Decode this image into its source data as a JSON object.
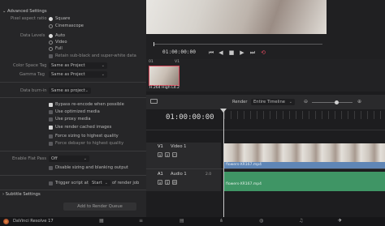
{
  "left_panel": {
    "advanced_settings": "Advanced Settings",
    "pixel_aspect_ratio_label": "Pixel aspect ratio",
    "pixel_aspect_options": [
      "Square",
      "Cinemascope"
    ],
    "data_levels_label": "Data Levels",
    "data_levels_options": [
      "Auto",
      "Video",
      "Full"
    ],
    "retain_checkbox": "Retain sub-black and super-white data",
    "color_space_tag_label": "Color Space Tag",
    "color_space_tag_value": "Same as Project",
    "gamma_tag_label": "Gamma Tag",
    "gamma_tag_value": "Same as Project",
    "data_burn_in_label": "Data burn-in",
    "data_burn_in_value": "Same as project",
    "checkboxes": [
      "Bypass re-encode when possible",
      "Use optimized media",
      "Use proxy media",
      "Use render cached images",
      "Force sizing to highest quality",
      "Force debayer to highest quality"
    ],
    "enable_flat_pass_label": "Enable Flat Pass",
    "enable_flat_pass_value": "Off",
    "disable_sizing": "Disable sizing and blanking output",
    "trigger_script_label": "Trigger script at",
    "trigger_script_value": "Start",
    "trigger_script_suffix": "of render job",
    "subtitle_settings": "Subtitle Settings",
    "add_to_render_queue": "Add to Render Queue"
  },
  "viewer": {
    "timecode": "01:00:00:00"
  },
  "media_pool": {
    "clip_number": "01",
    "clip_track": "V1",
    "clip_codec": "H.264 High L4.2"
  },
  "timeline": {
    "render_label": "Render",
    "render_value": "Entire Timeline",
    "timecode": "01:00:00:00",
    "video_track_id": "V1",
    "video_track_name": "Video 1",
    "audio_track_id": "A1",
    "audio_track_name": "Audio 1",
    "audio_track_level": "2.0",
    "video_clip_name": "flowers-XR167.mp4",
    "audio_clip_name": "flowers-XR167.mp4",
    "track_buttons_video": [
      "a",
      "o",
      "□"
    ],
    "track_buttons_audio": [
      "a",
      "S",
      "M"
    ]
  },
  "bottom_bar": {
    "app_name": "DaVinci Resolve 17",
    "active_page": "deliver",
    "pages": [
      "media",
      "cut",
      "edit",
      "fusion",
      "color",
      "fairlight",
      "deliver"
    ]
  },
  "colors": {
    "accent_red": "#d9485b",
    "video_clip": "#5f86b6",
    "audio_clip": "#3f9565"
  }
}
